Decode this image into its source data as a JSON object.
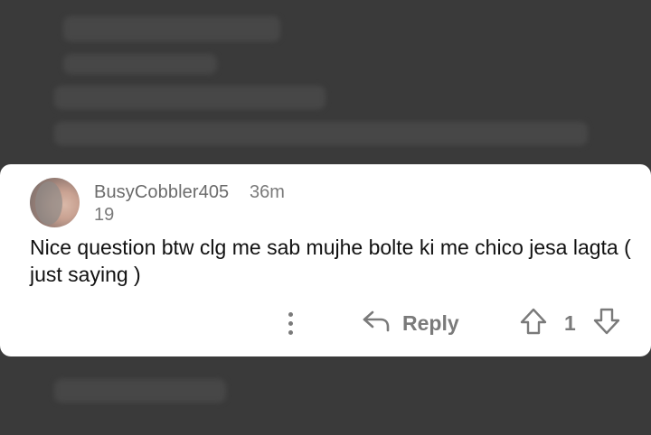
{
  "comment": {
    "username": "BusyCobbler405",
    "timestamp": "36m",
    "points": "19",
    "text": "Nice question btw clg me sab mujhe bolte ki me chico jesa lagta ( just saying )",
    "avatar_icon": "user-avatar"
  },
  "actions": {
    "more_icon": "more-vertical-icon",
    "reply_icon": "reply-arrow-icon",
    "reply_label": "Reply",
    "upvote_icon": "arrow-up-outline-icon",
    "vote_count": "1",
    "downvote_icon": "arrow-down-outline-icon"
  },
  "colors": {
    "background": "#3a3a3a",
    "card": "#ffffff",
    "text": "#111111",
    "meta": "#7a7a7a"
  }
}
